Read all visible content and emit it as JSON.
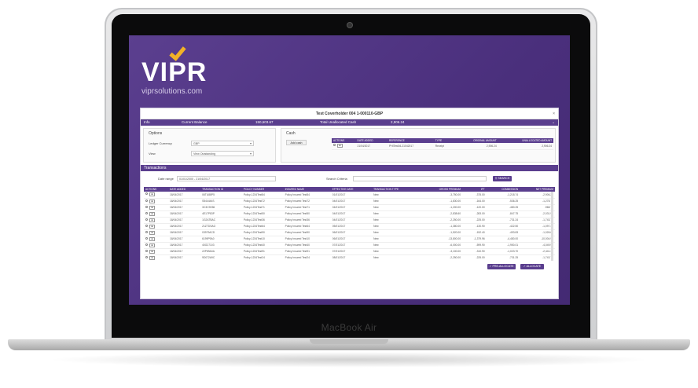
{
  "device": {
    "model": "MacBook Air"
  },
  "brand": {
    "name": "VIPR",
    "url": "viprsolutions.com",
    "accent": "#f2b227",
    "purple": "#5a3e8e"
  },
  "panel": {
    "title": "Test Coverholder 004 1-000110-GBP",
    "close": "×"
  },
  "info": {
    "label": "Info",
    "current_balance_label": "Current Balance",
    "current_balance_value": "150,603.67",
    "unallocated_label": "Total Unallocated Cash",
    "unallocated_value": "2,906.24"
  },
  "options": {
    "title": "Options",
    "ledger_currency_label": "Ledger Currency",
    "ledger_currency_value": "GBP",
    "view_label": "View",
    "view_value": "View Outstanding"
  },
  "cash": {
    "title": "Cash",
    "add_cash_label": "Add cash",
    "columns": [
      "ACTIONS",
      "DATE ADDED",
      "REFERENCE",
      "TYPE",
      "ORIGINAL AMOUNT",
      "UNALLOCATED AMOUNT"
    ],
    "rows": [
      [
        "21/04/2017",
        "PHITest04-21042017",
        "Receipt",
        "2,906.24",
        "2,906.24"
      ]
    ]
  },
  "transactions": {
    "title": "Transactions",
    "date_range_label": "Date range",
    "date_range_value": "01/01/2000 - 21/04/2017",
    "search_label": "Search Criteria",
    "search_placeholder": "",
    "search_button": "SEARCH",
    "columns": [
      "ACTIONS",
      "DATE ADDED",
      "TRANSACTION ID",
      "POLICY NUMBER",
      "INSURED NAME",
      "EFFECTIVE DATE",
      "TRANSACTION TYPE",
      "GROSS PREMIUM",
      "IPT",
      "COMMISSION",
      "NET PREMIUM"
    ],
    "rows": [
      [
        "18/04/2017",
        "06TU88P5",
        "Policy-1234Test84",
        "Policy Insured Test84",
        "01/01/2017",
        "New",
        "-3,750.00",
        "-375.00",
        "-1,218.74",
        "-2,906.26"
      ],
      [
        "18/04/2017",
        "S544444S",
        "Policy-1234Test72",
        "Policy Insured Test72",
        "04/01/2017",
        "New",
        "-1,830.00",
        "-164.00",
        "-536.25",
        "-1,278.75"
      ],
      [
        "18/04/2017",
        "3C3C9X56",
        "Policy-1234Test71",
        "Policy Insured Test71",
        "04/01/2017",
        "New",
        "-1,200.00",
        "-120.00",
        "-480.25",
        "-968.75"
      ],
      [
        "18/04/2017",
        "4E17P83P",
        "Policy-1234Test50",
        "Policy Insured Test50",
        "04/01/2017",
        "New",
        "-2,838.60",
        "-283.00",
        "-847.75",
        "-2,031.90"
      ],
      [
        "18/04/2017",
        "1G2ATBAC",
        "Policy-1234Test36",
        "Policy Insured Test36",
        "04/01/2017",
        "New",
        "-2,250.00",
        "-225.00",
        "-731.24",
        "-1,743.76"
      ],
      [
        "18/04/2017",
        "21ZTDSAG",
        "Policy-1234Test64",
        "Policy Insured Test64",
        "05/01/2017",
        "New",
        "-1,380.00",
        "-130.90",
        "-422.50",
        "-1,097.44"
      ],
      [
        "18/04/2017",
        "03979ACD",
        "Policy-1234Test90",
        "Policy Insured Test90",
        "06/01/2017",
        "New",
        "-1,520.00",
        "-152.40",
        "-493.83",
        "-1,026.66"
      ],
      [
        "18/04/2017",
        "6199P9A0",
        "Policy-1234Test10",
        "Policy Insured Test10",
        "06/01/2017",
        "New",
        "-13,800.00",
        "-1,379.96",
        "-4,480.00",
        "-10,004.99"
      ],
      [
        "18/04/2017",
        "40G27103",
        "Policy-1234Test40",
        "Policy Insured Test40",
        "07/01/2017",
        "New",
        "-6,000.00",
        "-599.90",
        "-1,950.01",
        "-4,049.99"
      ],
      [
        "18/04/2017",
        "22P89A0A",
        "Policy-1234Test91",
        "Policy Insured Test91",
        "07/01/2017",
        "New",
        "-3,100.00",
        "-310.90",
        "-1,023.70",
        "-2,441.34"
      ],
      [
        "18/04/2017",
        "9D072A9C",
        "Policy-1234Test24",
        "Policy Insured Test24",
        "08/01/2017",
        "New",
        "-2,250.00",
        "-225.00",
        "-731.25",
        "-1,743.74"
      ]
    ]
  },
  "footer": {
    "pre_allocate": "PRE-ALLOCATE",
    "allocate": "ALLOCATE"
  }
}
